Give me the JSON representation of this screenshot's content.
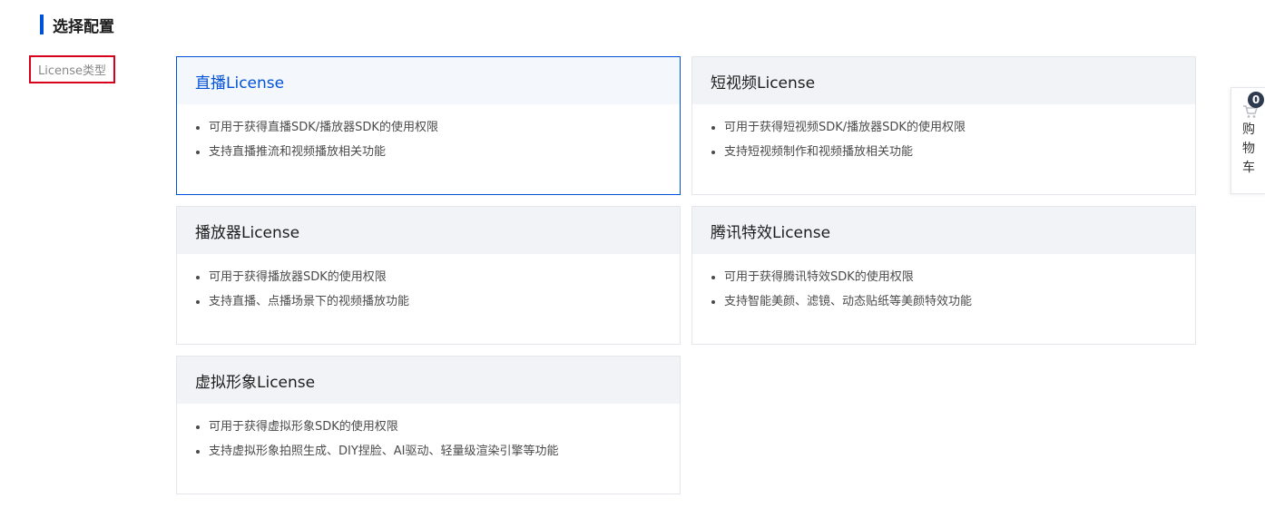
{
  "section": {
    "title": "选择配置"
  },
  "field": {
    "label": "License类型"
  },
  "cards": [
    {
      "title": "直播License",
      "selected": true,
      "features": [
        "可用于获得直播SDK/播放器SDK的使用权限",
        "支持直播推流和视频播放相关功能"
      ]
    },
    {
      "title": "短视频License",
      "selected": false,
      "features": [
        "可用于获得短视频SDK/播放器SDK的使用权限",
        "支持短视频制作和视频播放相关功能"
      ]
    },
    {
      "title": "播放器License",
      "selected": false,
      "features": [
        "可用于获得播放器SDK的使用权限",
        "支持直播、点播场景下的视频播放功能"
      ]
    },
    {
      "title": "腾讯特效License",
      "selected": false,
      "features": [
        "可用于获得腾讯特效SDK的使用权限",
        "支持智能美颜、滤镜、动态贴纸等美颜特效功能"
      ]
    },
    {
      "title": "虚拟形象License",
      "selected": false,
      "features": [
        "可用于获得虚拟形象SDK的使用权限",
        "支持虚拟形象拍照生成、DIY捏脸、AI驱动、轻量级渲染引擎等功能"
      ]
    }
  ],
  "cart": {
    "count": "0",
    "label": "购物车",
    "icon": "shopping-cart-icon"
  },
  "colors": {
    "accent": "#0052d9",
    "highlight_border": "#d9001b",
    "card_header_bg": "#f2f3f6"
  }
}
